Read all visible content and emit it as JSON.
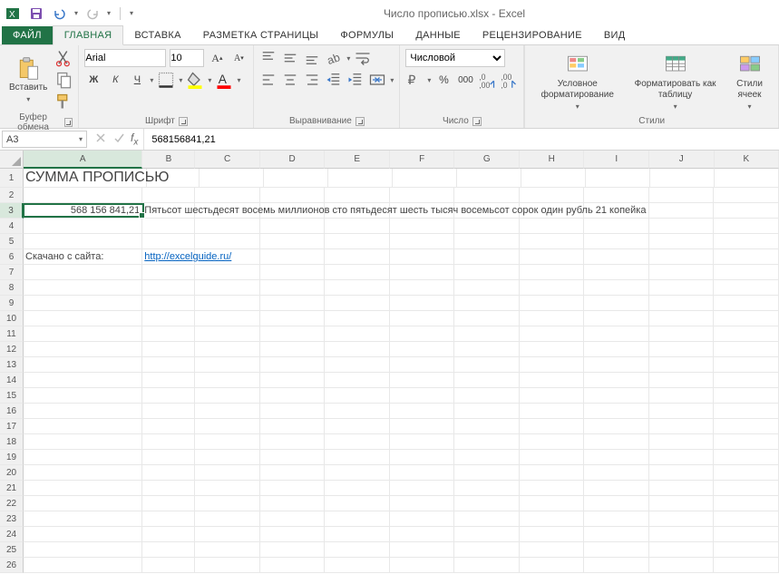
{
  "title": "Число прописью.xlsx - Excel",
  "tabs": {
    "file": "ФАЙЛ",
    "home": "ГЛАВНАЯ",
    "insert": "ВСТАВКА",
    "pagelayout": "РАЗМЕТКА СТРАНИЦЫ",
    "formulas": "ФОРМУЛЫ",
    "data": "ДАННЫЕ",
    "review": "РЕЦЕНЗИРОВАНИЕ",
    "view": "ВИД"
  },
  "ribbon": {
    "clipboard": {
      "paste": "Вставить",
      "label": "Буфер обмена"
    },
    "font": {
      "name": "Arial",
      "size": "10",
      "label": "Шрифт"
    },
    "alignment": {
      "label": "Выравнивание"
    },
    "number": {
      "format": "Числовой",
      "label": "Число"
    },
    "styles": {
      "conditional": "Условное форматирование",
      "table": "Форматировать как таблицу",
      "cell": "Стили ячеек",
      "label": "Стили"
    }
  },
  "namebox": "A3",
  "formula": "568156841,21",
  "columns": [
    "A",
    "B",
    "C",
    "D",
    "E",
    "F",
    "G",
    "H",
    "I",
    "J",
    "K"
  ],
  "rows_count": 26,
  "cells": {
    "A1": "СУММА ПРОПИСЬЮ",
    "A3": "568 156 841,21",
    "B3": "Пятьсот шестьдесят восемь миллионов сто пятьдесят шесть тысяч восемьсот сорок один рубль 21 копейка",
    "A6": "Скачано с сайта:",
    "B6": "http://excelguide.ru/"
  },
  "selected": {
    "ref": "A3",
    "row": 3,
    "col": "A"
  }
}
